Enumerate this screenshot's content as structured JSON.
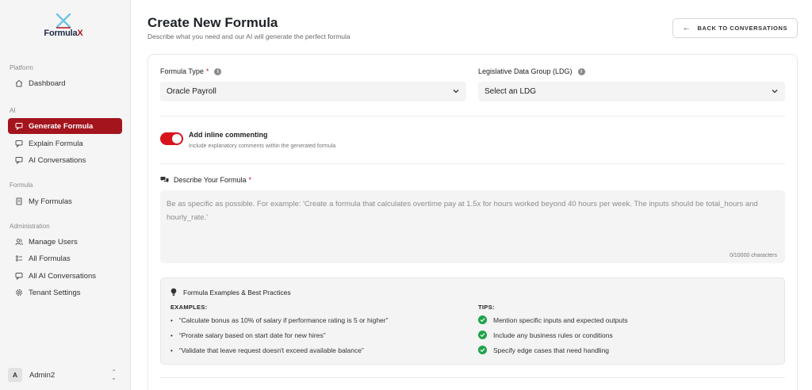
{
  "app": {
    "logo_text_main": "Formula",
    "logo_text_accent": "X",
    "brand_color": "#a3141c"
  },
  "sidebar": {
    "sections": [
      {
        "label": "Platform",
        "items": [
          {
            "label": "Dashboard",
            "icon": "home-icon"
          }
        ]
      },
      {
        "label": "AI",
        "items": [
          {
            "label": "Generate Formula",
            "icon": "chat-bubble-icon",
            "active": true
          },
          {
            "label": "Explain Formula",
            "icon": "message-icon"
          },
          {
            "label": "AI Conversations",
            "icon": "message-icon"
          }
        ]
      },
      {
        "label": "Formula",
        "items": [
          {
            "label": "My Formulas",
            "icon": "document-icon"
          }
        ]
      },
      {
        "label": "Administration",
        "items": [
          {
            "label": "Manage Users",
            "icon": "users-icon"
          },
          {
            "label": "All Formulas",
            "icon": "list-icon"
          },
          {
            "label": "All AI Conversations",
            "icon": "message-icon"
          },
          {
            "label": "Tenant Settings",
            "icon": "gear-icon"
          }
        ]
      }
    ],
    "user": {
      "initial": "A",
      "name": "Admin2"
    }
  },
  "header": {
    "title": "Create New Formula",
    "subtitle": "Describe what you need and our AI will generate the perfect formula",
    "back_button": "BACK TO CONVERSATIONS"
  },
  "form": {
    "formula_type": {
      "label": "Formula Type",
      "required_mark": "*",
      "value": "Oracle Payroll"
    },
    "ldg": {
      "label": "Legislative Data Group (LDG)",
      "value": "Select an LDG"
    },
    "inline_comment": {
      "label": "Add inline commenting",
      "description": "Include explanatory comments within the generated formula",
      "enabled": true
    },
    "describe": {
      "label": "Describe Your Formula",
      "required_mark": "*",
      "placeholder": "Be as specific as possible. For example: 'Create a formula that calculates overtime pay at 1.5x for hours worked beyond 40 hours per week. The inputs should be total_hours and hourly_rate.'",
      "char_count": "0/10000 characters"
    }
  },
  "examples": {
    "title": "Formula Examples & Best Practices",
    "examples_heading": "EXAMPLES:",
    "items": [
      "“Calculate bonus as 10% of salary if performance rating is 5 or higher”",
      "“Prorate salary based on start date for new hires”",
      "“Validate that leave request doesn't exceed available balance”"
    ],
    "tips_heading": "TIPS:",
    "tips": [
      "Mention specific inputs and expected outputs",
      "Include any business rules or conditions",
      "Specify edge cases that need handling"
    ]
  }
}
